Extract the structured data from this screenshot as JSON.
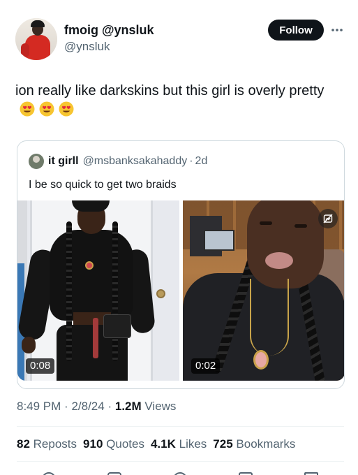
{
  "tweet": {
    "author": {
      "display_name": "fmoig @ynsluk",
      "handle": "@ynsluk"
    },
    "follow_label": "Follow",
    "text": "ion really like darkskins but this girl is overly pretty",
    "emojis": [
      "heart-eyes-emoji",
      "heart-eyes-emoji",
      "heart-eyes-emoji"
    ],
    "quoted": {
      "author_name": "it girll",
      "handle": "@msbanksakahaddy",
      "separator": "·",
      "time": "2d",
      "text": "I be so quick to get two braids",
      "media": [
        {
          "type": "video",
          "duration": "0:08"
        },
        {
          "type": "video",
          "duration": "0:02",
          "icon": "sensitive-content-icon"
        }
      ]
    },
    "meta": {
      "time": "8:49 PM",
      "date": "2/8/24",
      "separator": "·",
      "views_count": "1.2M",
      "views_label": "Views"
    },
    "stats": [
      {
        "count": "82",
        "label": "Reposts"
      },
      {
        "count": "910",
        "label": "Quotes"
      },
      {
        "count": "4.1K",
        "label": "Likes"
      },
      {
        "count": "725",
        "label": "Bookmarks"
      }
    ]
  },
  "colors": {
    "primary_text": "#0f1419",
    "secondary_text": "#536471",
    "border": "#cfd9de",
    "follow_button_bg": "#0f1419"
  }
}
